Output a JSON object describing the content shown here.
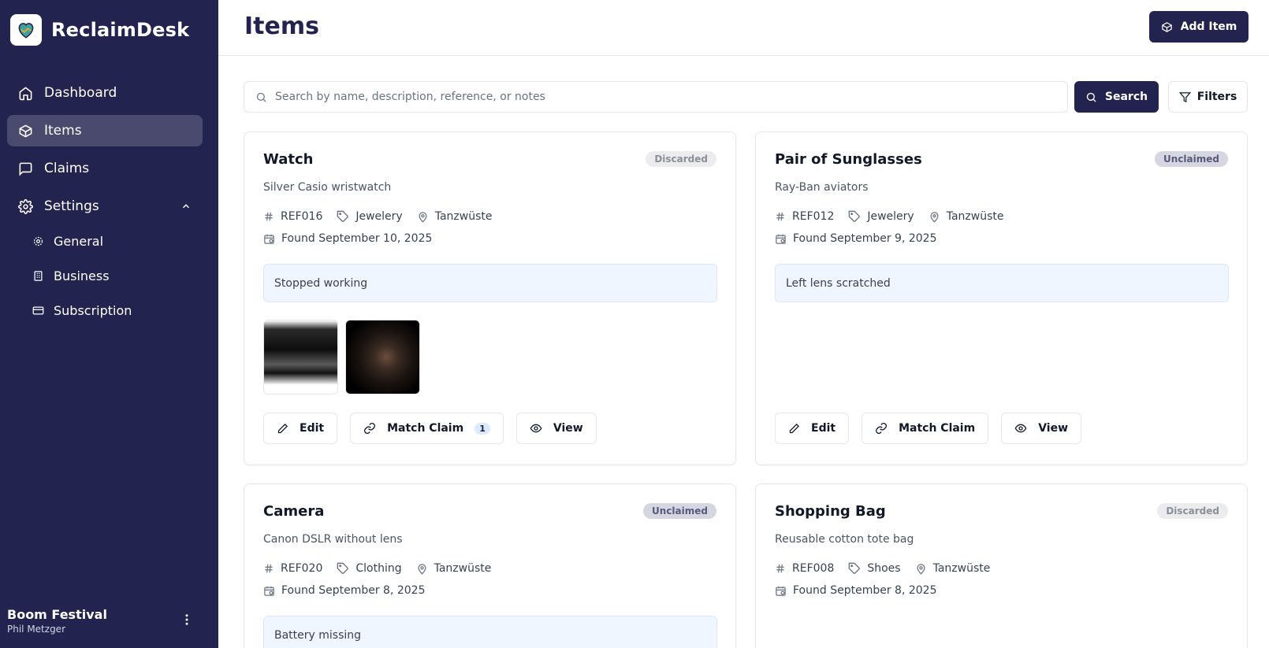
{
  "app": {
    "name": "ReclaimDesk"
  },
  "sidebar": {
    "items": [
      {
        "label": "Dashboard"
      },
      {
        "label": "Items"
      },
      {
        "label": "Claims"
      },
      {
        "label": "Settings"
      }
    ],
    "settings_sub": [
      {
        "label": "General"
      },
      {
        "label": "Business"
      },
      {
        "label": "Subscription"
      }
    ],
    "org": {
      "name": "Boom Festival",
      "user": "Phil Metzger"
    }
  },
  "header": {
    "title": "Items",
    "add_label": "Add Item"
  },
  "search": {
    "placeholder": "Search by name, description, reference, or notes",
    "value": "",
    "button_label": "Search",
    "filters_label": "Filters"
  },
  "actions": {
    "edit": "Edit",
    "match": "Match Claim",
    "view": "View"
  },
  "items": [
    {
      "title": "Watch",
      "status": "Discarded",
      "description": "Silver Casio wristwatch",
      "ref": "REF016",
      "category": "Jewelery",
      "location": "Tanzwüste",
      "found": "Found September 10, 2025",
      "note": "Stopped working",
      "match_count": "1"
    },
    {
      "title": "Pair of Sunglasses",
      "status": "Unclaimed",
      "description": "Ray-Ban aviators",
      "ref": "REF012",
      "category": "Jewelery",
      "location": "Tanzwüste",
      "found": "Found September 9, 2025",
      "note": "Left lens scratched"
    },
    {
      "title": "Camera",
      "status": "Unclaimed",
      "description": "Canon DSLR without lens",
      "ref": "REF020",
      "category": "Clothing",
      "location": "Tanzwüste",
      "found": "Found September 8, 2025",
      "note": "Battery missing"
    },
    {
      "title": "Shopping Bag",
      "status": "Discarded",
      "description": "Reusable cotton tote bag",
      "ref": "REF008",
      "category": "Shoes",
      "location": "Tanzwüste",
      "found": "Found September 8, 2025"
    }
  ],
  "colors": {
    "brand": "#23234f",
    "note_bg": "#eff6ff",
    "badge_discarded": "#ececef",
    "badge_unclaimed": "#d6d6e2"
  }
}
